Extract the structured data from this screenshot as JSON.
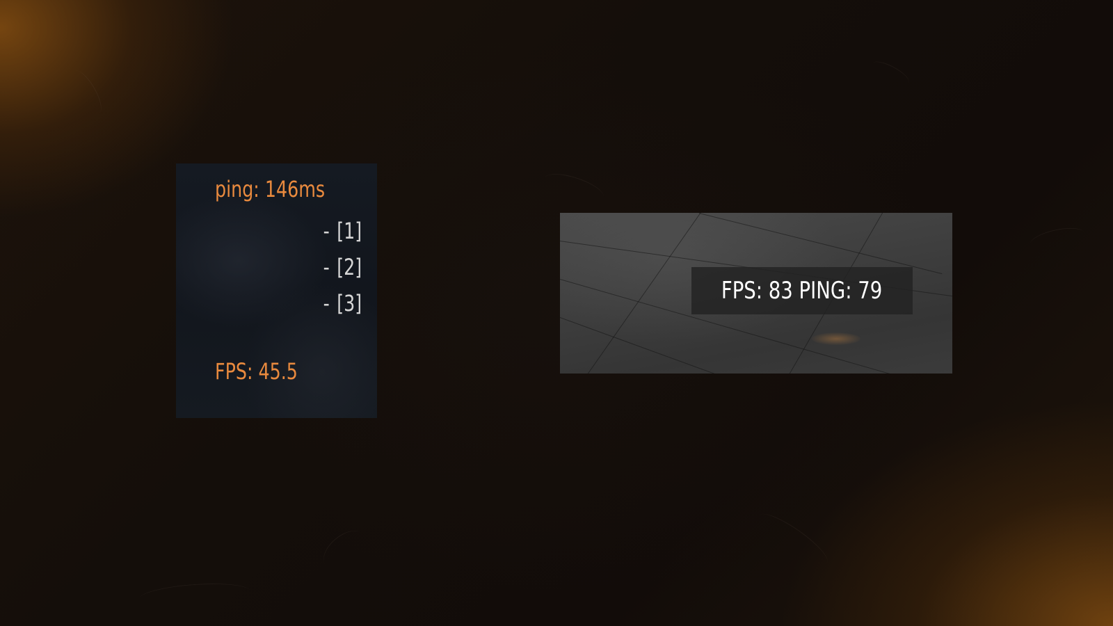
{
  "left_panel": {
    "ping": "ping: 146ms",
    "items": [
      {
        "dash": "-",
        "label": "[1]"
      },
      {
        "dash": "-",
        "label": "[2]"
      },
      {
        "dash": "-",
        "label": "[3]"
      }
    ],
    "fps": "FPS: 45.5"
  },
  "right_panel": {
    "text": "FPS: 83 PING: 79"
  },
  "colors": {
    "accent": "#e98a3e",
    "item_text": "#d6d6d6",
    "overlay_text": "#ffffff"
  }
}
